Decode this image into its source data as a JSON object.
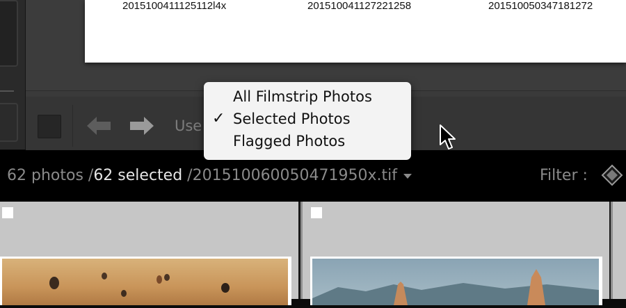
{
  "print_captions": [
    "2015100411125112l4x",
    "201510041127221258",
    "201510050347181272"
  ],
  "toolbar": {
    "use_label": "Use"
  },
  "menu": {
    "items": [
      "All Filmstrip Photos",
      "Selected Photos",
      "Flagged Photos"
    ],
    "selected_index": 1,
    "check_mark": "✓"
  },
  "status": {
    "count": "62 photos /",
    "selected": "62 selected",
    "filename": "/201510060050471950x.tif",
    "filter_label": "Filter :"
  },
  "colors": {
    "panel_bg": "#353535",
    "status_bg": "#000000",
    "menu_bg": "#f3f3f3",
    "filmstrip_cell": "#c6c6c6"
  },
  "icons": [
    "back-arrow-icon",
    "forward-arrow-icon",
    "check-icon",
    "dropdown-caret-icon",
    "filter-lock-icon",
    "mouse-cursor-icon"
  ]
}
